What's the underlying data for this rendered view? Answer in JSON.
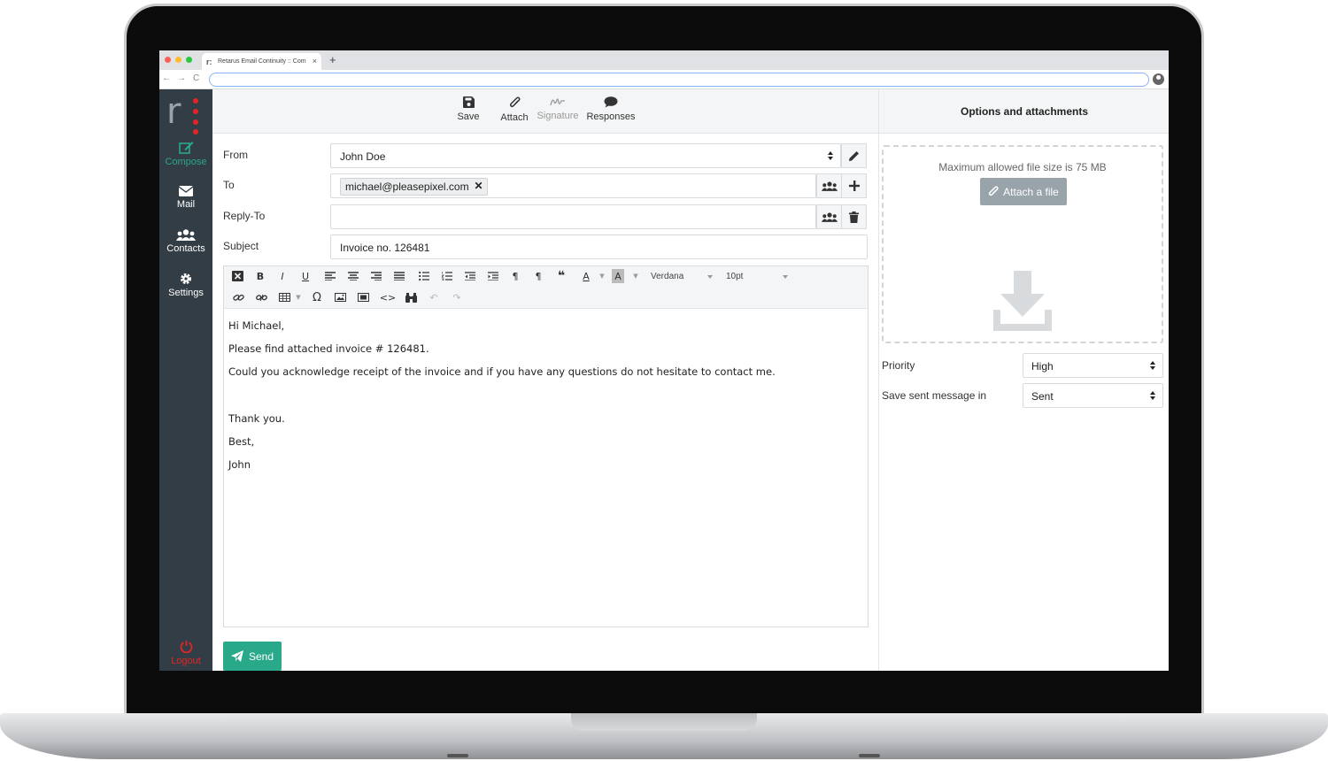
{
  "browser": {
    "tab_title": "Retarus Email Continuity :: Com",
    "tab_close": "×",
    "new_tab": "+",
    "back": "←",
    "forward": "→",
    "reload": "C"
  },
  "sidebar": {
    "compose": "Compose",
    "mail": "Mail",
    "contacts": "Contacts",
    "settings": "Settings",
    "logout": "Logout"
  },
  "toolbar": {
    "save": "Save",
    "attach": "Attach",
    "signature": "Signature",
    "responses": "Responses"
  },
  "form": {
    "from_label": "From",
    "from_value": "John Doe",
    "to_label": "To",
    "to_recipient": "michael@pleasepixel.com",
    "chip_remove": "✕",
    "replyto_label": "Reply-To",
    "replyto_value": "",
    "subject_label": "Subject",
    "subject_value": "Invoice no. 126481"
  },
  "editor": {
    "font": "Verdana",
    "size": "10pt",
    "lines": [
      "Hi Michael,",
      "Please find attached invoice # 126481.",
      "Could you acknowledge receipt of the invoice and if you have any questions do not hesitate to contact me.",
      "Thank you.",
      "Best,",
      "John"
    ]
  },
  "send_label": "Send",
  "options": {
    "title": "Options and attachments",
    "max_size": "Maximum allowed file size is 75 MB",
    "attach_file": "Attach a file",
    "priority_label": "Priority",
    "priority_value": "High",
    "save_sent_label": "Save sent message in",
    "save_sent_value": "Sent"
  },
  "colors": {
    "accent": "#2aa88a",
    "sidebar": "#323d45",
    "logout": "#e42524"
  }
}
